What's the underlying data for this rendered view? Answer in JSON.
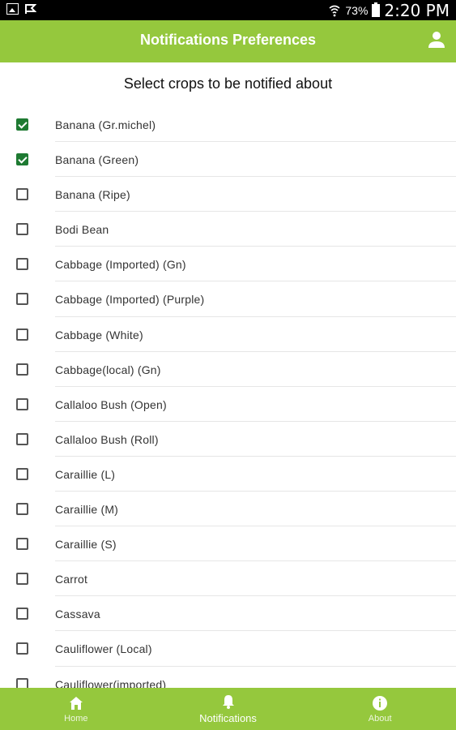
{
  "status_bar": {
    "battery": "73%",
    "time": "2:20 PM",
    "icons": [
      "image-icon",
      "signal-flag-icon",
      "wifi-icon",
      "battery-icon"
    ]
  },
  "appbar": {
    "title": "Notifications Preferences",
    "right_icon": "profile-icon"
  },
  "main": {
    "heading": "Select crops to be notified about",
    "crops": [
      {
        "label": "Banana (Gr.michel)",
        "checked": true
      },
      {
        "label": "Banana (Green)",
        "checked": true
      },
      {
        "label": "Banana (Ripe)",
        "checked": false
      },
      {
        "label": "Bodi Bean",
        "checked": false
      },
      {
        "label": "Cabbage (Imported) (Gn)",
        "checked": false
      },
      {
        "label": "Cabbage (Imported) (Purple)",
        "checked": false
      },
      {
        "label": "Cabbage (White)",
        "checked": false
      },
      {
        "label": "Cabbage(local) (Gn)",
        "checked": false
      },
      {
        "label": "Callaloo Bush (Open)",
        "checked": false
      },
      {
        "label": "Callaloo Bush (Roll)",
        "checked": false
      },
      {
        "label": "Caraillie (L)",
        "checked": false
      },
      {
        "label": "Caraillie (M)",
        "checked": false
      },
      {
        "label": "Caraillie (S)",
        "checked": false
      },
      {
        "label": "Carrot",
        "checked": false
      },
      {
        "label": "Cassava",
        "checked": false
      },
      {
        "label": "Cauliflower (Local)",
        "checked": false
      },
      {
        "label": "Cauliflower(imported)",
        "checked": false
      }
    ]
  },
  "bottom_nav": {
    "items": [
      {
        "label": "Home",
        "icon": "home-icon",
        "active": false
      },
      {
        "label": "Notifications",
        "icon": "bell-icon",
        "active": true
      },
      {
        "label": "About",
        "icon": "info-icon",
        "active": false
      }
    ]
  },
  "colors": {
    "primary": "#95c83d",
    "checkbox_checked": "#1e7a32",
    "status_bar": "#000000"
  }
}
